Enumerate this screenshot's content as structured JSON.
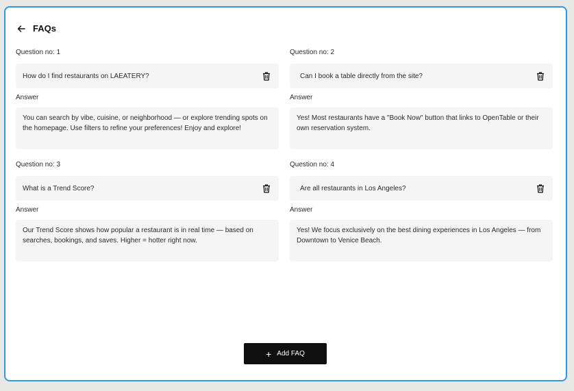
{
  "header": {
    "title": "FAQs",
    "back_icon": "arrow-left-icon"
  },
  "faqs": [
    {
      "question_label": "Question no: 1",
      "question": "How do I find restaurants on LAEATERY?",
      "answer_label": "Answer",
      "answer": "You can search by vibe, cuisine, or neighborhood — or explore trending spots on the homepage. Use filters to refine your preferences! Enjoy and explore!"
    },
    {
      "question_label": "Question no: 2",
      "question": "Can I book a table directly from the site?",
      "answer_label": "Answer",
      "answer": "Yes! Most restaurants have a \"Book Now\" button that links to OpenTable or their own reservation system."
    },
    {
      "question_label": "Question no: 3",
      "question": "What is a Trend Score?",
      "answer_label": "Answer",
      "answer": "Our Trend Score shows how popular a restaurant is in real time — based on searches, bookings, and saves. Higher = hotter right now."
    },
    {
      "question_label": "Question no: 4",
      "question": "Are all restaurants in Los Angeles?",
      "answer_label": "Answer",
      "answer": "Yes! We focus exclusively on the best dining experiences in Los Angeles — from Downtown to Venice Beach."
    }
  ],
  "actions": {
    "add_label": "Add FAQ",
    "add_icon": "+"
  },
  "colors": {
    "accent_border": "#2f97e8",
    "button_bg": "#0f0f0f",
    "field_bg": "#f5f5f5"
  }
}
